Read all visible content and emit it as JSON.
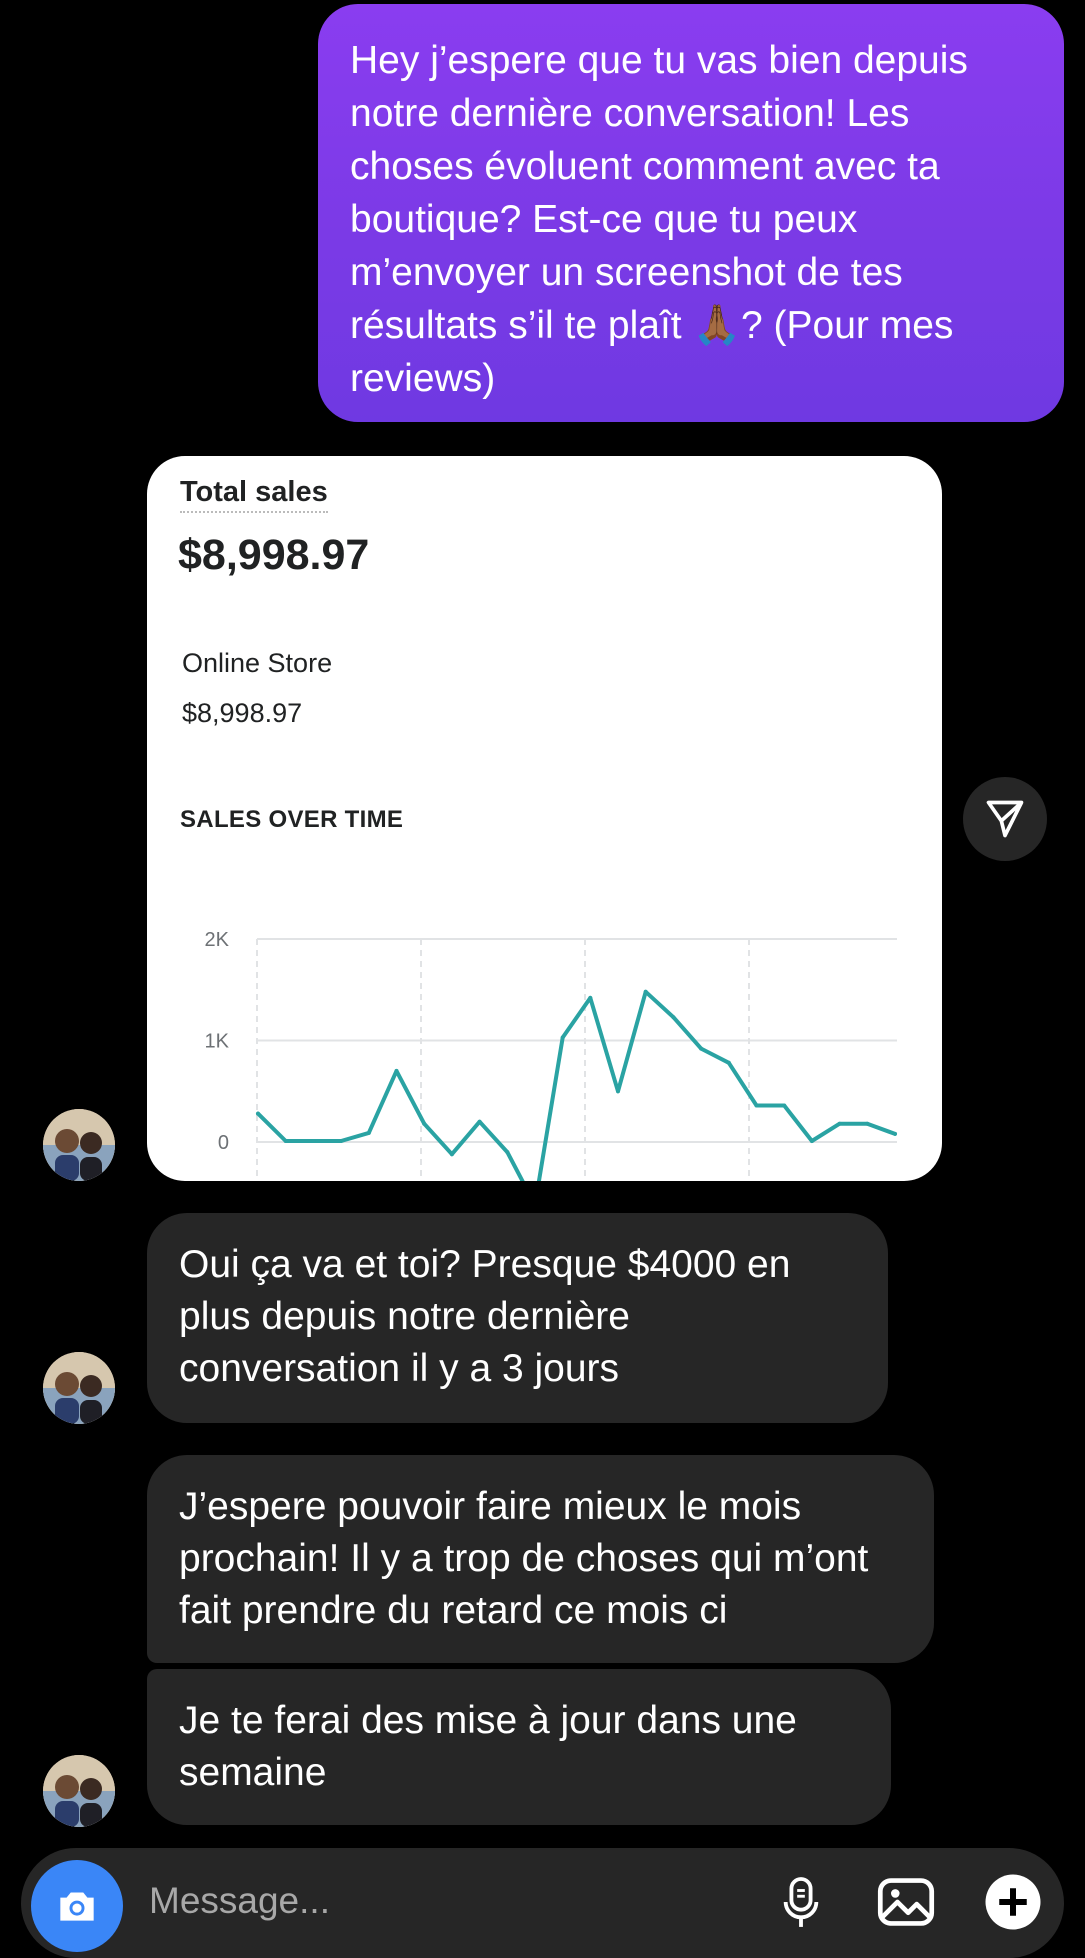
{
  "messages": {
    "outgoing": {
      "text": "Hey j’espere que tu vas bien depuis notre dernière conversation! Les choses évoluent comment avec ta boutique? Est-ce que tu peux m’envoyer un screenshot de tes résultats s’il te plaît 🙏🏾? (Pour mes reviews)"
    },
    "shared_screenshot": {
      "title": "Total sales",
      "total": "$8,998.97",
      "store_label": "Online Store",
      "store_value": "$8,998.97",
      "chart_title": "SALES OVER TIME",
      "line_color": "#2aa3a3"
    },
    "incoming": [
      {
        "text": "Oui ça va et toi? Presque $4000 en plus depuis notre dernière conversation il y a 3 jours"
      },
      {
        "text": "J’espere pouvoir faire mieux le mois prochain! Il y a trop de choses qui m’ont fait prendre du retard ce mois ci"
      },
      {
        "text": "Je te ferai des mise à jour dans une semaine"
      }
    ]
  },
  "composer": {
    "placeholder": "Message..."
  },
  "chart_data": {
    "type": "line",
    "title": "SALES OVER TIME",
    "y_tick_labels": [
      "2K",
      "1K",
      "0"
    ],
    "ylim": [
      -900,
      2000
    ],
    "grid": true,
    "series": [
      {
        "values": [
          280,
          10,
          10,
          10,
          90,
          700,
          180,
          -120,
          200,
          -100,
          -620,
          1030,
          1420,
          500,
          1480,
          1230,
          920,
          780,
          360,
          360,
          10,
          180,
          180,
          80
        ]
      }
    ],
    "line_color": "#2aa3a3"
  }
}
